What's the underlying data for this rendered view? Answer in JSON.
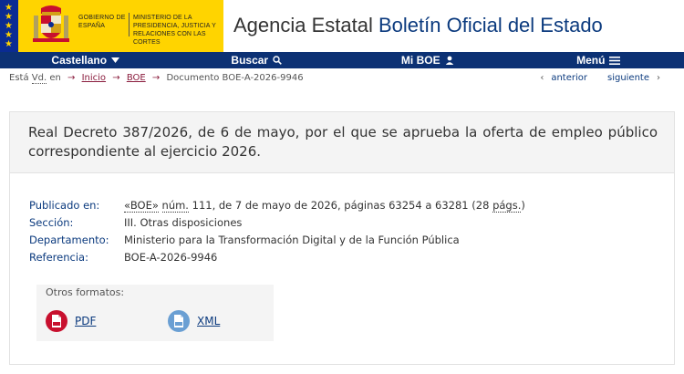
{
  "header": {
    "gov_line1": "GOBIERNO DE ESPAÑA",
    "gov_line2": "MINISTERIO DE LA PRESIDENCIA, JUSTICIA Y RELACIONES CON LAS CORTES",
    "title_part1": "Agencia Estatal ",
    "title_part2": "Boletín Oficial del Estado",
    "colors": {
      "navy": "#0c3174",
      "yellow": "#ffd400",
      "flag_blue": "#0a2b93"
    }
  },
  "nav": {
    "language": "Castellano",
    "search": "Buscar",
    "my_boe": "Mi BOE",
    "menu": "Menú"
  },
  "breadcrumb": {
    "prefix_a": "Está ",
    "prefix_abbr": "Vd.",
    "prefix_b": " en",
    "items": [
      "Inicio",
      "BOE"
    ],
    "current": "Documento BOE-A-2026-9946"
  },
  "pager": {
    "previous": "anterior",
    "next": "siguiente"
  },
  "document": {
    "title": "Real Decreto 387/2026, de 6 de mayo, por el que se aprueba la oferta de empleo público correspondiente al ejercicio 2026.",
    "meta": {
      "published_label": "Publicado en:",
      "published_boe": "«BOE»",
      "published_num": "núm.",
      "published_rest_a": " 111, de 7 de mayo de 2026, páginas 63254 a 63281 (28 ",
      "published_pags": "págs.",
      "published_rest_b": ")",
      "section_label": "Sección:",
      "section_value": "III. Otras disposiciones",
      "department_label": "Departamento:",
      "department_value": "Ministerio para la Transformación Digital y de la Función Pública",
      "reference_label": "Referencia:",
      "reference_value": "BOE-A-2026-9946"
    },
    "formats": {
      "title": "Otros formatos:",
      "pdf": "PDF",
      "xml": "XML"
    }
  }
}
